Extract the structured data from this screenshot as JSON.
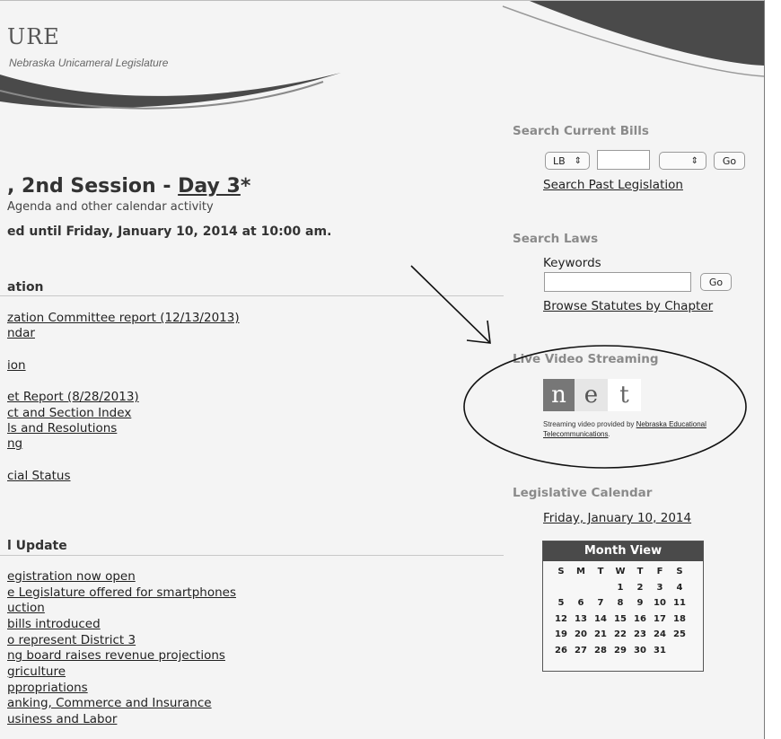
{
  "header": {
    "logo_title": "URE",
    "logo_subtitle": "Nebraska Unicameral Legislature"
  },
  "session": {
    "title_prefix": ", 2nd Session - ",
    "day_link": "Day 3",
    "title_suffix": "*",
    "subtitle": "Agenda and other calendar activity",
    "adjourn": "ed until Friday, January 10, 2014 at 10:00 am."
  },
  "legislation": {
    "heading": "ation",
    "links": [
      "zation Committee report (12/13/2013)",
      "ndar",
      "ion",
      "et Report (8/28/2013)",
      "ct and Section Index",
      "ls and Resolutions",
      "ng",
      "cial Status"
    ]
  },
  "update": {
    "heading": "l Update",
    "links": [
      "egistration now open",
      "e Legislature offered for smartphones",
      "uction",
      "bills introduced",
      "o represent District 3",
      "ng board raises revenue projections",
      "griculture",
      "ppropriations",
      "anking, Commerce and Insurance",
      "usiness and Labor"
    ]
  },
  "sidebar": {
    "search_bills": {
      "heading": "Search Current Bills",
      "type_select": "LB",
      "go_label": "Go",
      "past_link": "Search Past Legislation"
    },
    "search_laws": {
      "heading": "Search Laws",
      "keywords_label": "Keywords",
      "go_label": "Go",
      "browse_link": "Browse Statutes by Chapter"
    },
    "video": {
      "heading": "Live Video Streaming",
      "logo_letters": [
        "n",
        "e",
        "t"
      ],
      "note_prefix": "Streaming video provided by ",
      "note_link1": "Nebraska Educational",
      "note_link2": "Telecommunications",
      "note_suffix": "."
    },
    "calendar": {
      "heading": "Legislative Calendar",
      "date_link": "Friday, January 10, 2014",
      "month_view": "Month View",
      "weekdays": [
        "S",
        "M",
        "T",
        "W",
        "T",
        "F",
        "S"
      ],
      "days": [
        "1",
        "2",
        "3",
        "4",
        "5",
        "6",
        "7",
        "8",
        "9",
        "10",
        "11",
        "12",
        "13",
        "14",
        "15",
        "16",
        "17",
        "18",
        "19",
        "20",
        "21",
        "22",
        "23",
        "24",
        "25",
        "26",
        "27",
        "28",
        "29",
        "30",
        "31"
      ]
    }
  },
  "colors": {
    "background": "#f4f4f4",
    "swoosh": "#4a4a4a",
    "sidebar_heading": "#8a8a8a"
  }
}
